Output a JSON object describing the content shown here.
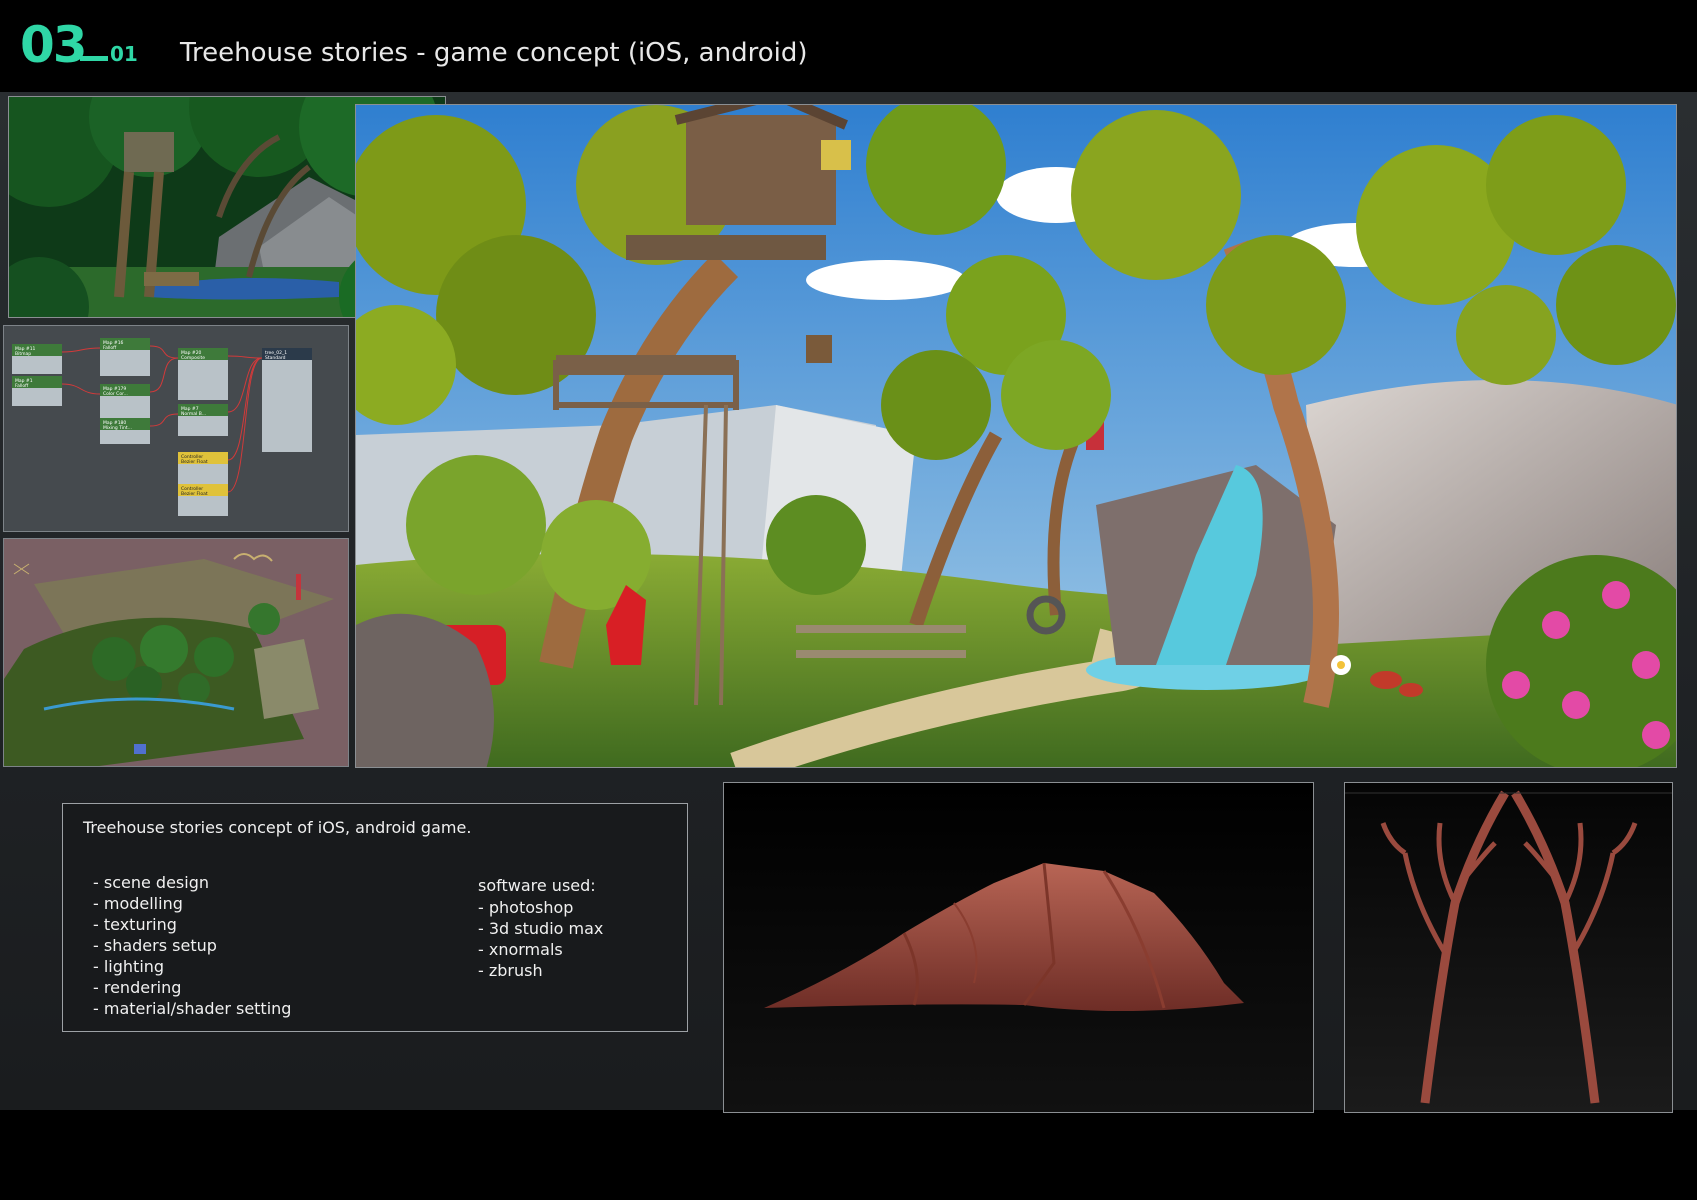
{
  "header": {
    "number": "03",
    "sub_number": "01",
    "title": "Treehouse stories - game concept (iOS, android)"
  },
  "nodes": [
    {
      "title": "Map #11",
      "sub": "Bitmap"
    },
    {
      "title": "Map #16",
      "sub": "Falloff"
    },
    {
      "title": "Map #20",
      "sub": "Composite"
    },
    {
      "title": "tree_02_1",
      "sub": "Standard"
    },
    {
      "title": "Map #1",
      "sub": "Falloff"
    },
    {
      "title": "Map #179",
      "sub": "Color Cor..."
    },
    {
      "title": "Map #7",
      "sub": "Normal B..."
    },
    {
      "title": "Map #180",
      "sub": "Mixing Tint..."
    },
    {
      "title": "Controller",
      "sub": "Bezier Float"
    },
    {
      "title": "Controller",
      "sub": "Bezier Float"
    }
  ],
  "description": {
    "intro": "Treehouse stories concept of  iOS, android game.",
    "tasks": [
      "- scene design",
      "- modelling",
      "- texturing",
      "- shaders setup",
      "- lighting",
      "- rendering",
      "- material/shader setting"
    ],
    "software_title": "software used:",
    "software": [
      "- photoshop",
      "- 3d studio max",
      "- xnormals",
      "- zbrush"
    ]
  },
  "colors": {
    "accent": "#2fd7a6",
    "background": "#000000",
    "board": "#24282b",
    "sculpt_clay": "#9a4a3e"
  }
}
